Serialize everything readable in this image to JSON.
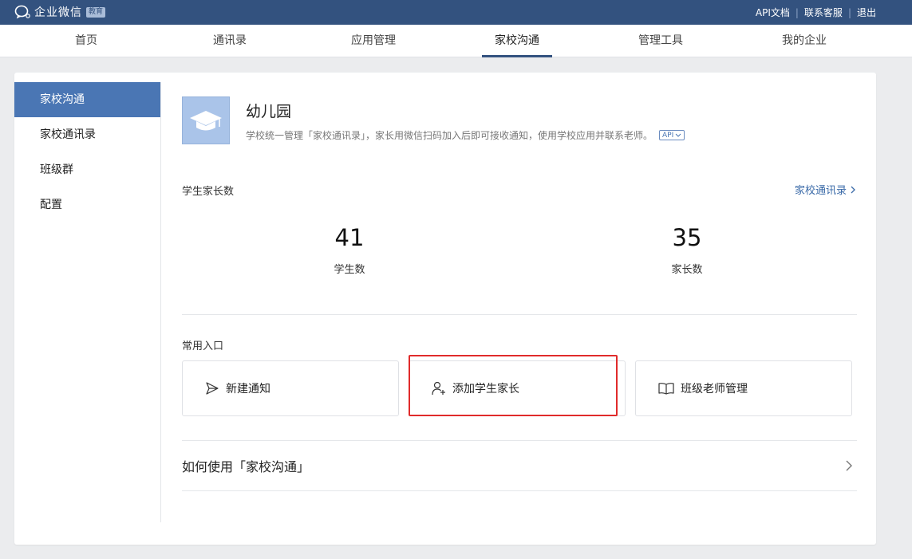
{
  "topbar": {
    "brand": "企业微信",
    "badge": "教育",
    "links": [
      "API文档",
      "联系客服",
      "退出"
    ],
    "separator": "|"
  },
  "nav": {
    "items": [
      "首页",
      "通讯录",
      "应用管理",
      "家校沟通",
      "管理工具",
      "我的企业"
    ],
    "active": "家校沟通"
  },
  "sidebar": {
    "items": [
      "家校沟通",
      "家校通讯录",
      "班级群",
      "配置"
    ],
    "active": "家校沟通"
  },
  "app": {
    "title": "幼儿园",
    "description": "学校统一管理「家校通讯录」，家长用微信扫码加入后即可接收通知，使用学校应用并联系老师。",
    "api_tag": "API"
  },
  "stats_section": {
    "label": "学生家长数",
    "link": "家校通讯录",
    "students": {
      "value": "41",
      "label": "学生数"
    },
    "parents": {
      "value": "35",
      "label": "家长数"
    }
  },
  "entries_section": {
    "label": "常用入口",
    "entries": [
      {
        "label": "新建通知",
        "icon": "send-icon"
      },
      {
        "label": "添加学生家长",
        "icon": "add-user-icon"
      },
      {
        "label": "班级老师管理",
        "icon": "book-icon"
      }
    ]
  },
  "howto": {
    "label": "如何使用「家校沟通」"
  },
  "colors": {
    "topbar": "#33527f",
    "sidebar_active": "#4a76b4",
    "link": "#3a6aa8",
    "highlight": "#e02b2b"
  }
}
